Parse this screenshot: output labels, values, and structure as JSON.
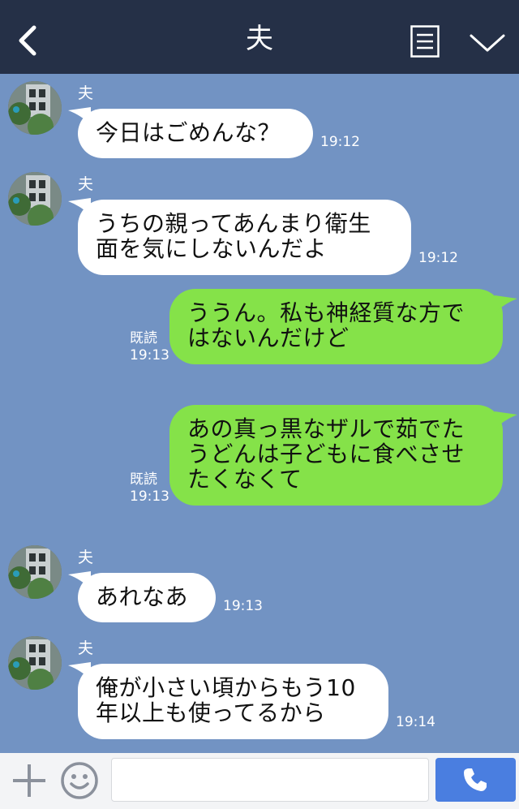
{
  "header": {
    "title": "夫",
    "back_icon": "chevron-left-icon",
    "menu_icon": "list-icon",
    "chevron_icon": "chevron-down-icon"
  },
  "colors": {
    "header": "#253047",
    "chat_background": "#7293c3",
    "incoming_bubble": "#ffffff",
    "outgoing_bubble": "#85e249",
    "send_button": "#4a7ee0"
  },
  "messages": [
    {
      "direction": "in",
      "sender": "夫",
      "lines": [
        "今日はごめんな？"
      ],
      "time": "19:12"
    },
    {
      "direction": "in",
      "sender": "夫",
      "lines": [
        "うちの親ってあんまり衛生",
        "面を気にしないんだよ"
      ],
      "time": "19:12"
    },
    {
      "direction": "out",
      "read": "既読",
      "lines": [
        "ううん。私も神経質な方で",
        "はないんだけど"
      ],
      "time": "19:13"
    },
    {
      "direction": "out",
      "read": "既読",
      "lines": [
        "あの真っ黒なザルで茹でた",
        "うどんは子どもに食べさせ",
        "たくなくて"
      ],
      "time": "19:13"
    },
    {
      "direction": "in",
      "sender": "夫",
      "lines": [
        "あれなあ"
      ],
      "time": "19:13"
    },
    {
      "direction": "in",
      "sender": "夫",
      "lines": [
        "俺が小さい頃からもう10",
        "年以上も使ってるから"
      ],
      "time": "19:14"
    }
  ],
  "footer": {
    "plus_icon": "plus-icon",
    "emoji_icon": "smiley-icon",
    "input_value": "",
    "send_icon": "phone-icon"
  }
}
